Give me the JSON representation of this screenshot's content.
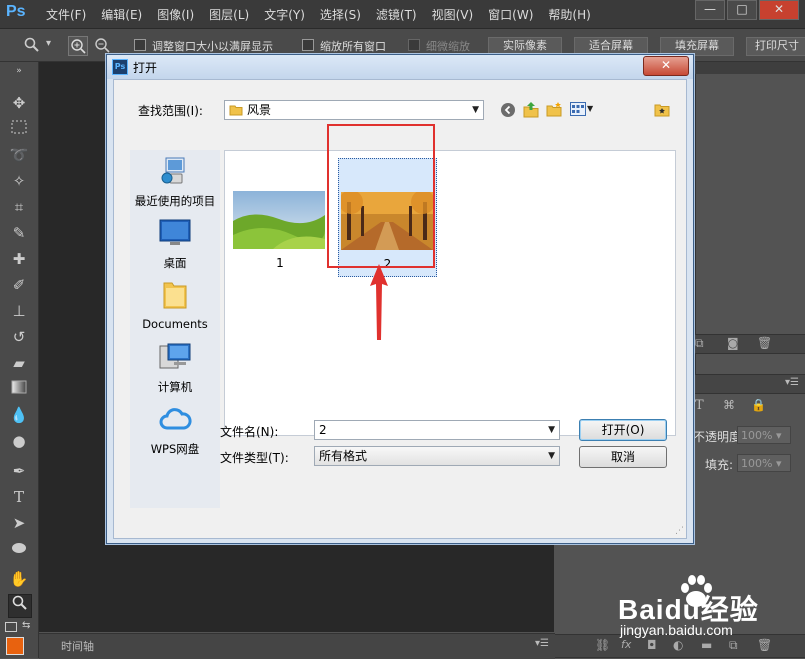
{
  "app": {
    "logo": "Ps",
    "menus": [
      "文件(F)",
      "编辑(E)",
      "图像(I)",
      "图层(L)",
      "文字(Y)",
      "选择(S)",
      "滤镜(T)",
      "视图(V)",
      "窗口(W)",
      "帮助(H)"
    ],
    "window_controls": [
      "—",
      "□",
      "✕"
    ]
  },
  "options_bar": {
    "zoom_dropdown": "▾",
    "chk_resize": "调整窗口大小以满屏显示",
    "chk_zoom_all": "缩放所有窗口",
    "chk_scrubby": "细微缩放",
    "btn_actual": "实际像素",
    "btn_fit": "适合屏幕",
    "btn_fill": "填充屏幕",
    "btn_print": "打印尺寸"
  },
  "panels": {
    "opacity_label": "不透明度:",
    "opacity_value": "100%",
    "fill_label": "填充:",
    "fill_value": "100%"
  },
  "timeline": {
    "label": "时间轴"
  },
  "dialog": {
    "title": "打开",
    "look_in_label": "查找范围(I):",
    "look_in_value": "风景",
    "places": [
      "最近使用的项目",
      "桌面",
      "Documents",
      "计算机",
      "WPS网盘"
    ],
    "files": [
      {
        "name": "1",
        "selected": false
      },
      {
        "name": "2",
        "selected": true
      }
    ],
    "filename_label": "文件名(N):",
    "filename_value": "2",
    "filetype_label": "文件类型(T):",
    "filetype_value": "所有格式",
    "open_button": "打开(O)",
    "cancel_button": "取消"
  },
  "watermark": {
    "brand": "Baidu经验",
    "url": "jingyan.baidu.com"
  },
  "colors": {
    "highlight_box": "#e0312e",
    "ps_blue": "#5ab4ff",
    "close_red": "#c7412f"
  }
}
